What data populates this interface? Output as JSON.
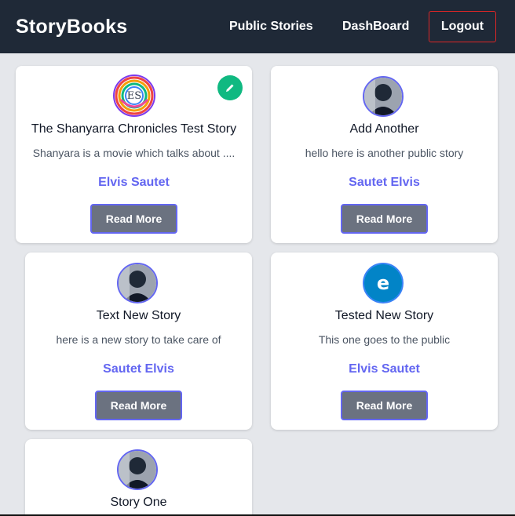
{
  "navbar": {
    "brand": "StoryBooks",
    "links": [
      "Public Stories",
      "DashBoard"
    ],
    "logout_label": "Logout"
  },
  "stories": [
    {
      "title": "The Shanyarra Chronicles Test Story",
      "body": "Shanyara is a movie  which talks about ....",
      "author": "Elvis Sautet",
      "button": "Read More",
      "avatar": "ES",
      "editable": true
    },
    {
      "title": "Add Another",
      "body": "hello here is another public story",
      "author": "Sautet Elvis",
      "button": "Read More",
      "avatar": "photo"
    },
    {
      "title": "Text New Story",
      "body": "here is a new story to take care of",
      "author": "Sautet Elvis",
      "button": "Read More",
      "avatar": "photo"
    },
    {
      "title": "Tested New Story",
      "body": "This one goes to the public",
      "author": "Elvis Sautet",
      "button": "Read More",
      "avatar": "e"
    },
    {
      "title": "Story One",
      "avatar": "photo"
    }
  ],
  "colors": {
    "navbar": "#1f2937",
    "accent": "#6366f1",
    "button": "#6b7280",
    "edit": "#10b981",
    "logout_border": "#dc2626"
  },
  "icons": {
    "edit": "pencil-icon"
  }
}
